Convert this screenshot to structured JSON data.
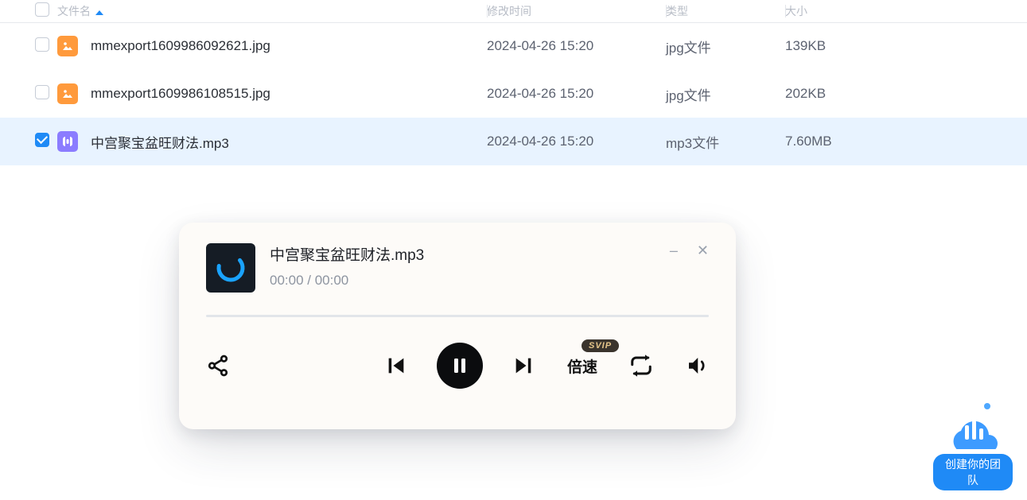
{
  "columns": {
    "name": "文件名",
    "time": "修改时间",
    "type": "类型",
    "size": "大小"
  },
  "files": [
    {
      "name": "mmexport1609986092621.jpg",
      "time": "2024-04-26 15:20",
      "type": "jpg文件",
      "size": "139KB",
      "kind": "img",
      "selected": false
    },
    {
      "name": "mmexport1609986108515.jpg",
      "time": "2024-04-26 15:20",
      "type": "jpg文件",
      "size": "202KB",
      "kind": "img",
      "selected": false
    },
    {
      "name": "中宫聚宝盆旺财法.mp3",
      "time": "2024-04-26 15:20",
      "type": "mp3文件",
      "size": "7.60MB",
      "kind": "aud",
      "selected": true
    }
  ],
  "player": {
    "title": "中宫聚宝盆旺财法.mp3",
    "elapsed": "00:00",
    "total": "00:00",
    "speed_label": "倍速",
    "svip": "SVIP"
  },
  "team_button": "创建你的团队"
}
